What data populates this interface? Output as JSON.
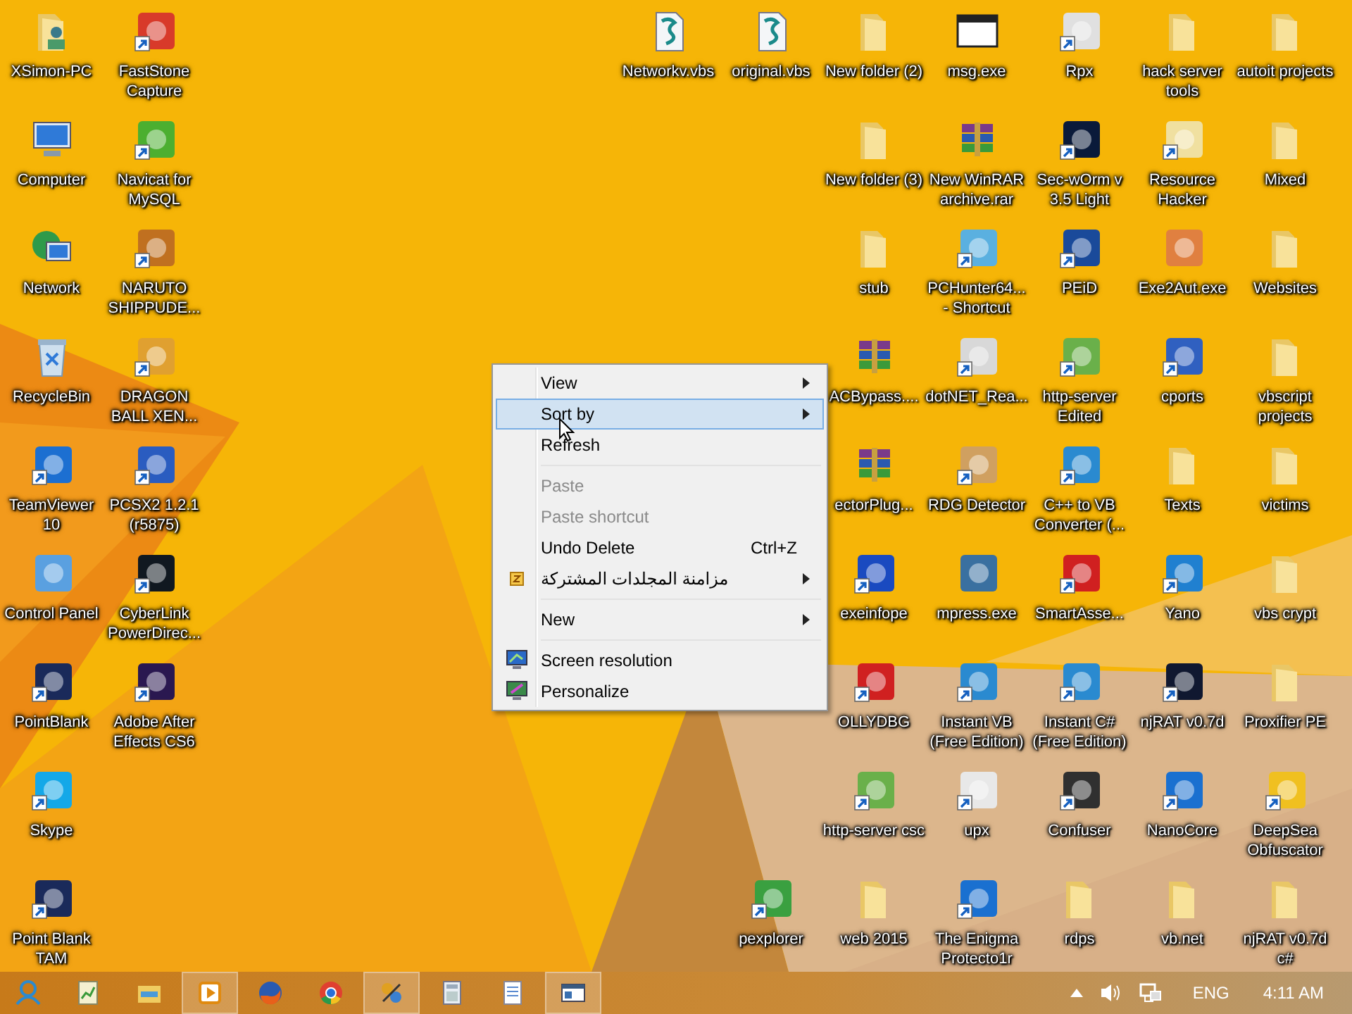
{
  "desktop": {
    "columns": [
      {
        "icons": [
          {
            "label": "XSimon-PC",
            "kind": "userfolder"
          },
          {
            "label": "Computer",
            "kind": "monitor"
          },
          {
            "label": "Network",
            "kind": "globe"
          },
          {
            "label": "RecycleBin",
            "kind": "bin"
          },
          {
            "label": "TeamViewer 10",
            "kind": "app",
            "color": "#1c6fd1",
            "shortcut": true
          },
          {
            "label": "Control Panel",
            "kind": "app",
            "color": "#5aa0e0"
          },
          {
            "label": "PointBlank",
            "kind": "app",
            "color": "#1a2a5a",
            "shortcut": true
          },
          {
            "label": "Skype",
            "kind": "app",
            "color": "#14a8e8",
            "shortcut": true
          },
          {
            "label": "Point Blank TAM",
            "kind": "app",
            "color": "#1a2a5a",
            "shortcut": true
          }
        ]
      },
      {
        "icons": [
          {
            "label": "FastStone Capture",
            "kind": "app",
            "color": "#d83a2a",
            "shortcut": true
          },
          {
            "label": "Navicat for MySQL",
            "kind": "app",
            "color": "#4caf30",
            "shortcut": true
          },
          {
            "label": "NARUTO SHIPPUDE...",
            "kind": "app",
            "color": "#c07020",
            "shortcut": true
          },
          {
            "label": "DRAGON BALL XEN...",
            "kind": "app",
            "color": "#e0a030",
            "shortcut": true
          },
          {
            "label": "PCSX2 1.2.1 (r5875)",
            "kind": "app",
            "color": "#2a5cc0",
            "shortcut": true
          },
          {
            "label": "CyberLink PowerDirec...",
            "kind": "app",
            "color": "#101820",
            "shortcut": true
          },
          {
            "label": "Adobe After Effects CS6",
            "kind": "app",
            "color": "#2a1850",
            "shortcut": true
          }
        ]
      },
      {
        "icons": [
          {
            "label": "Networkv.vbs",
            "kind": "script"
          }
        ]
      },
      {
        "icons": [
          {
            "label": "original.vbs",
            "kind": "script"
          }
        ]
      },
      {
        "icons": [
          {
            "label": "New folder (2)",
            "kind": "folder"
          },
          {
            "label": "New folder (3)",
            "kind": "folder"
          },
          {
            "label": "stub",
            "kind": "folder"
          },
          {
            "label": "ACBypass....",
            "kind": "archive"
          },
          {
            "label": "ectorPlug...",
            "kind": "archive"
          },
          {
            "label": "exeinfope",
            "kind": "app",
            "color": "#1a4ac0",
            "shortcut": true
          },
          {
            "label": "OLLYDBG",
            "kind": "app",
            "color": "#d02020",
            "shortcut": true
          },
          {
            "label": "http-server csc",
            "kind": "app",
            "color": "#6ab04a",
            "shortcut": true
          },
          {
            "label": "web 2015",
            "kind": "folder"
          }
        ]
      },
      {
        "icons": [
          {
            "label": "msg.exe",
            "kind": "window"
          },
          {
            "label": "New WinRAR archive.rar",
            "kind": "archive"
          },
          {
            "label": "PCHunter64... - Shortcut",
            "kind": "app",
            "color": "#5ab0e0",
            "shortcut": true
          },
          {
            "label": "dotNET_Rea...",
            "kind": "app",
            "color": "#d8d8d8",
            "shortcut": true
          },
          {
            "label": "RDG Detector",
            "kind": "app",
            "color": "#d0a060",
            "shortcut": true
          },
          {
            "label": "mpress.exe",
            "kind": "app",
            "color": "#3a70a0"
          },
          {
            "label": "Instant VB (Free Edition)",
            "kind": "app",
            "color": "#2a8ad0",
            "shortcut": true
          },
          {
            "label": "upx",
            "kind": "app",
            "color": "#e8e8e8",
            "shortcut": true
          },
          {
            "label": "The Enigma Protecto1r",
            "kind": "app",
            "color": "#1a70d0",
            "shortcut": true
          }
        ]
      },
      {
        "icons": [
          {
            "label": "Rpx",
            "kind": "app",
            "color": "#e0e0e0",
            "shortcut": true
          },
          {
            "label": "Sec-wOrm v 3.5 Light",
            "kind": "app",
            "color": "#0a1a3a",
            "shortcut": true
          },
          {
            "label": "PEiD",
            "kind": "app",
            "color": "#1a4a9a",
            "shortcut": true
          },
          {
            "label": "http-server Edited",
            "kind": "app",
            "color": "#6ab04a",
            "shortcut": true
          },
          {
            "label": "C++ to VB Converter (...",
            "kind": "app",
            "color": "#2a8ad0",
            "shortcut": true
          },
          {
            "label": "SmartAsse...",
            "kind": "app",
            "color": "#d02020",
            "shortcut": true
          },
          {
            "label": "Instant C# (Free Edition)",
            "kind": "app",
            "color": "#2a8ad0",
            "shortcut": true
          },
          {
            "label": "Confuser",
            "kind": "app",
            "color": "#303030",
            "shortcut": true
          },
          {
            "label": "rdps",
            "kind": "folder"
          }
        ]
      },
      {
        "icons": [
          {
            "label": "hack server tools",
            "kind": "folder"
          },
          {
            "label": "Resource Hacker",
            "kind": "app",
            "color": "#f0e0a0",
            "shortcut": true
          },
          {
            "label": "Exe2Aut.exe",
            "kind": "app",
            "color": "#e08040"
          },
          {
            "label": "cports",
            "kind": "app",
            "color": "#3060c0",
            "shortcut": true
          },
          {
            "label": "Texts",
            "kind": "folder"
          },
          {
            "label": "Yano",
            "kind": "app",
            "color": "#2080d0",
            "shortcut": true
          },
          {
            "label": "njRAT v0.7d",
            "kind": "app",
            "color": "#101830",
            "shortcut": true
          },
          {
            "label": "NanoCore",
            "kind": "app",
            "color": "#1a70d0",
            "shortcut": true
          },
          {
            "label": "vb.net",
            "kind": "folder"
          }
        ]
      },
      {
        "icons": [
          {
            "label": "autoit projects",
            "kind": "folder"
          },
          {
            "label": "Mixed",
            "kind": "folder"
          },
          {
            "label": "Websites",
            "kind": "folder"
          },
          {
            "label": "vbscript projects",
            "kind": "folder"
          },
          {
            "label": "victims",
            "kind": "folder"
          },
          {
            "label": "vbs crypt",
            "kind": "folder"
          },
          {
            "label": "Proxifier PE",
            "kind": "folder"
          },
          {
            "label": "DeepSea Obfuscator",
            "kind": "app",
            "color": "#f0c020",
            "shortcut": true
          },
          {
            "label": "njRAT v0.7d c#",
            "kind": "folder"
          }
        ]
      }
    ],
    "bottom_icons": [
      {
        "label": "pexplorer",
        "kind": "app",
        "color": "#3aa040",
        "shortcut": true
      }
    ]
  },
  "context_menu": {
    "items": [
      {
        "kind": "item",
        "label": "View",
        "submenu": true,
        "selected": false,
        "disabled": false
      },
      {
        "kind": "item",
        "label": "Sort by",
        "submenu": true,
        "selected": true,
        "disabled": false
      },
      {
        "kind": "item",
        "label": "Refresh",
        "submenu": false,
        "selected": false,
        "disabled": false
      },
      {
        "kind": "separator"
      },
      {
        "kind": "item",
        "label": "Paste",
        "submenu": false,
        "selected": false,
        "disabled": true
      },
      {
        "kind": "item",
        "label": "Paste shortcut",
        "submenu": false,
        "selected": false,
        "disabled": true
      },
      {
        "kind": "item",
        "label": "Undo Delete",
        "shortcut": "Ctrl+Z",
        "submenu": false,
        "selected": false,
        "disabled": false
      },
      {
        "kind": "sync",
        "label": "مزامنة المجلدات المشتركة",
        "submenu": true,
        "selected": false,
        "disabled": false
      },
      {
        "kind": "separator"
      },
      {
        "kind": "item",
        "label": "New",
        "submenu": true,
        "selected": false,
        "disabled": false
      },
      {
        "kind": "separator"
      },
      {
        "kind": "display",
        "label": "Screen resolution",
        "submenu": false,
        "selected": false,
        "disabled": false
      },
      {
        "kind": "personalize",
        "label": "Personalize",
        "submenu": false,
        "selected": false,
        "disabled": false
      }
    ]
  },
  "taskbar": {
    "items": [
      {
        "kind": "people",
        "selected": false
      },
      {
        "kind": "notepad",
        "selected": false
      },
      {
        "kind": "explorer",
        "selected": false
      },
      {
        "kind": "media",
        "selected": true
      },
      {
        "kind": "firefox",
        "selected": false
      },
      {
        "kind": "chrome",
        "selected": false
      },
      {
        "kind": "tool",
        "selected": true
      },
      {
        "kind": "calculator",
        "selected": false
      },
      {
        "kind": "notes",
        "selected": false
      },
      {
        "kind": "window",
        "selected": true
      }
    ],
    "language": "ENG",
    "time": "4:11 AM"
  }
}
